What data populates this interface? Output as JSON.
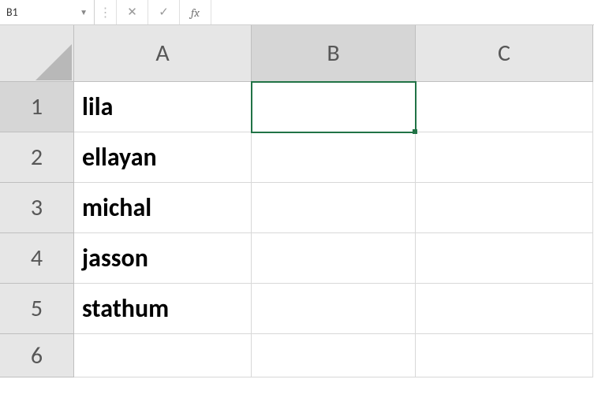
{
  "name_box": {
    "value": "B1"
  },
  "formula_bar": {
    "cancel": "✕",
    "enter": "✓",
    "fx": "fx",
    "value": ""
  },
  "columns": [
    "A",
    "B",
    "C"
  ],
  "rows": [
    "1",
    "2",
    "3",
    "4",
    "5",
    "6"
  ],
  "cells": {
    "A1": "lila",
    "A2": "ellayan",
    "A3": "michal",
    "A4": "jasson",
    "A5": "stathum"
  },
  "selected_cell": "B1",
  "chart_data": {
    "type": "table",
    "columns": [
      "A"
    ],
    "rows": [
      {
        "A": "lila"
      },
      {
        "A": "ellayan"
      },
      {
        "A": "michal"
      },
      {
        "A": "jasson"
      },
      {
        "A": "stathum"
      }
    ]
  }
}
